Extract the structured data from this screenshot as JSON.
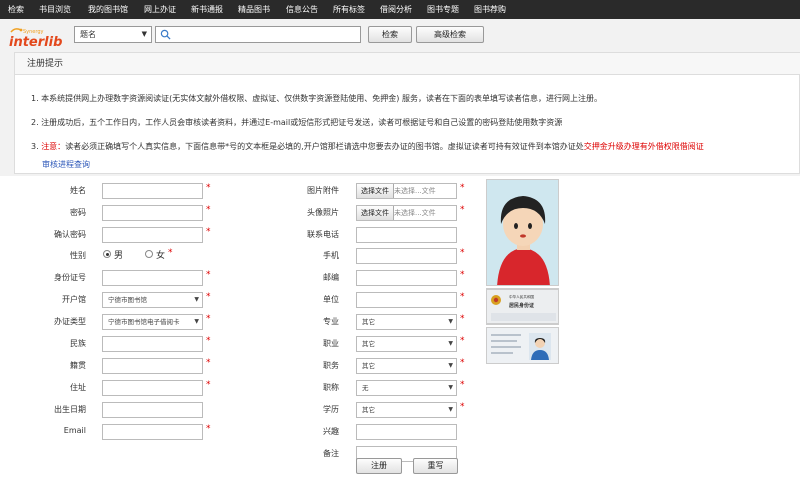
{
  "nav": [
    "检索",
    "书目浏览",
    "我的图书馆",
    "网上办证",
    "新书通报",
    "精品图书",
    "信息公告",
    "所有标签",
    "借阅分析",
    "图书专题",
    "图书荐购"
  ],
  "logo": {
    "small_text": "Synergy",
    "brand_text": "interlib",
    "brand_color": "#e3481c"
  },
  "search": {
    "field_type": "题名",
    "query": "",
    "search_button": "检索",
    "advanced_button": "高级检索"
  },
  "notice": {
    "title": "注册提示",
    "item1": "1. 本系统提供网上办理数字资源阅读证(无实体文献外借权限、虚拟证、仅供数字资源登陆使用、免押金) 服务，读者在下面的表单填写读者信息，进行网上注册。",
    "item2": "2. 注册成功后，五个工作日内，工作人员会审核读者资料，并通过E-mail或短信形式把证号发送，读者可根据证号和自己设置的密码登陆使用数字资源",
    "item3_num": "3.",
    "item3_label": "注意：",
    "item3_body": "读者必须正确填写个人真实信息，下面信息带*号的文本框是必填的,开户馆那栏请选中您要去办证的图书馆。虚拟证读者可持有效证件到本馆办证处",
    "item3_link": "交押金升级办理有外借权限借阅证",
    "item3_link2": "审核进程查询"
  },
  "form": {
    "left": [
      {
        "label": "姓名",
        "type": "text",
        "value": "",
        "required": true
      },
      {
        "label": "密码",
        "type": "text",
        "value": "",
        "required": true
      },
      {
        "label": "确认密码",
        "type": "text",
        "value": "",
        "required": true
      },
      {
        "label": "性别",
        "type": "radio",
        "options": [
          "男",
          "女"
        ],
        "selected": "男",
        "required": true
      },
      {
        "label": "身份证号",
        "type": "text",
        "value": "",
        "required": true
      },
      {
        "label": "开户馆",
        "type": "select",
        "value": "宁德市图书馆",
        "required": true
      },
      {
        "label": "办证类型",
        "type": "select",
        "value": "宁德市图书馆电子借阅卡",
        "required": true
      },
      {
        "label": "民族",
        "type": "text",
        "value": "",
        "required": true
      },
      {
        "label": "籍贯",
        "type": "text",
        "value": "",
        "required": true
      },
      {
        "label": "住址",
        "type": "text",
        "value": "",
        "required": true
      },
      {
        "label": "出生日期",
        "type": "text",
        "value": "",
        "required": false
      },
      {
        "label": "Email",
        "type": "text",
        "value": "",
        "required": true
      }
    ],
    "right": [
      {
        "label": "图片附件",
        "type": "file",
        "button": "选择文件",
        "value": "未选择...文件",
        "required": true
      },
      {
        "label": "头像照片",
        "type": "file",
        "button": "选择文件",
        "value": "未选择...文件",
        "required": true
      },
      {
        "label": "联系电话",
        "type": "text",
        "value": "",
        "required": false
      },
      {
        "label": "手机",
        "type": "text",
        "value": "",
        "required": true
      },
      {
        "label": "邮编",
        "type": "text",
        "value": "",
        "required": true
      },
      {
        "label": "单位",
        "type": "text",
        "value": "",
        "required": true
      },
      {
        "label": "专业",
        "type": "select",
        "value": "其它",
        "required": true
      },
      {
        "label": "职业",
        "type": "select",
        "value": "其它",
        "required": true
      },
      {
        "label": "职务",
        "type": "select",
        "value": "其它",
        "required": true
      },
      {
        "label": "职称",
        "type": "select",
        "value": "无",
        "required": true
      },
      {
        "label": "学历",
        "type": "select",
        "value": "其它",
        "required": true
      },
      {
        "label": "兴趣",
        "type": "text",
        "value": "",
        "required": false
      },
      {
        "label": "备注",
        "type": "text",
        "value": "",
        "required": false
      }
    ],
    "submit_button": "注册",
    "reset_button": "重写"
  },
  "id_card": {
    "title": "中华人民共和国",
    "subtitle": "居民身份证"
  },
  "colors": {
    "nav_bg": "#2a2a2a",
    "required": "#dd0000",
    "link": "#2b56b8",
    "warning": "#dd0000"
  }
}
